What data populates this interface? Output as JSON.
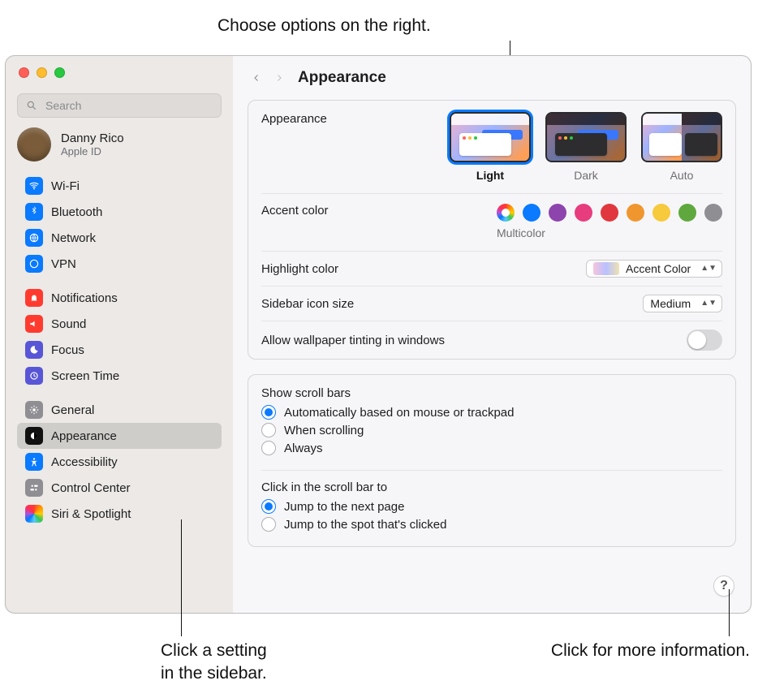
{
  "callouts": {
    "top": "Choose options on the right.",
    "sidebar_l1": "Click a setting",
    "sidebar_l2": "in the sidebar.",
    "help": "Click for more information."
  },
  "sidebar": {
    "search_placeholder": "Search",
    "user": {
      "name": "Danny Rico",
      "subtitle": "Apple ID"
    },
    "groups": [
      {
        "items": [
          {
            "label": "Wi-Fi"
          },
          {
            "label": "Bluetooth"
          },
          {
            "label": "Network"
          },
          {
            "label": "VPN"
          }
        ]
      },
      {
        "items": [
          {
            "label": "Notifications"
          },
          {
            "label": "Sound"
          },
          {
            "label": "Focus"
          },
          {
            "label": "Screen Time"
          }
        ]
      },
      {
        "items": [
          {
            "label": "General"
          },
          {
            "label": "Appearance",
            "selected": true
          },
          {
            "label": "Accessibility"
          },
          {
            "label": "Control Center"
          },
          {
            "label": "Siri & Spotlight"
          }
        ]
      }
    ]
  },
  "content": {
    "title": "Appearance",
    "appearance": {
      "label": "Appearance",
      "modes": [
        "Light",
        "Dark",
        "Auto"
      ],
      "selected": "Light"
    },
    "accent": {
      "label": "Accent color",
      "selected_label": "Multicolor",
      "colors": [
        "multicolor",
        "#0a7aff",
        "#8e44ad",
        "#e73c7e",
        "#e0383e",
        "#f0962f",
        "#f7c93c",
        "#5fa83e",
        "#8e8e93"
      ],
      "selected_index": 0
    },
    "highlight": {
      "label": "Highlight color",
      "value": "Accent Color"
    },
    "sidebar_icon": {
      "label": "Sidebar icon size",
      "value": "Medium"
    },
    "wallpaper_tint": {
      "label": "Allow wallpaper tinting in windows",
      "value": false
    },
    "scroll": {
      "heading": "Show scroll bars",
      "options": [
        "Automatically based on mouse or trackpad",
        "When scrolling",
        "Always"
      ],
      "selected_index": 0
    },
    "click_scroll": {
      "heading": "Click in the scroll bar to",
      "options": [
        "Jump to the next page",
        "Jump to the spot that's clicked"
      ],
      "selected_index": 0
    }
  }
}
